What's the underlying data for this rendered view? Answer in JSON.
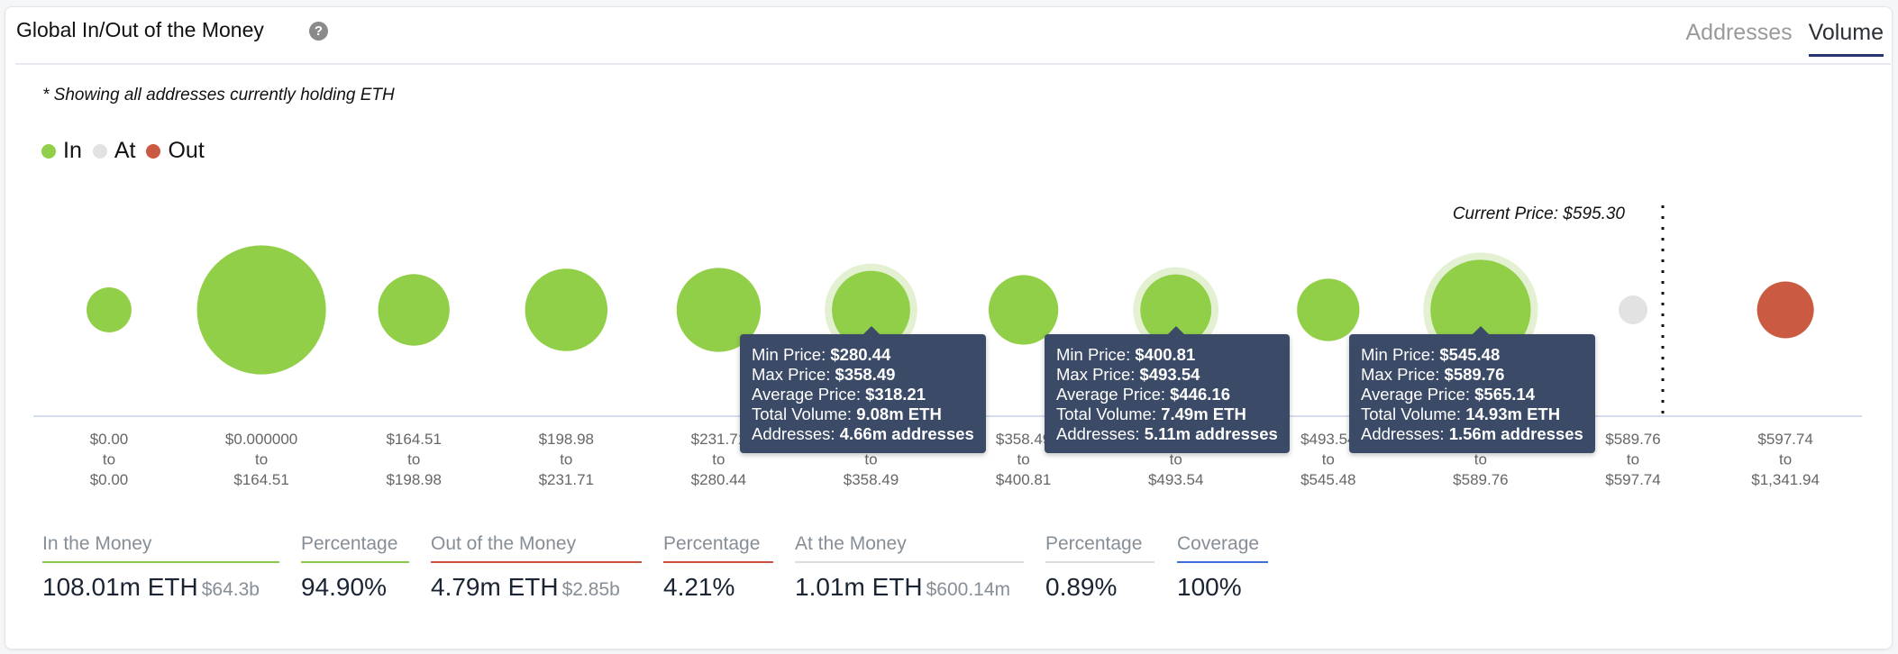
{
  "header": {
    "title": "Global In/Out of the Money",
    "help_icon": "question-circle-icon",
    "tabs": [
      {
        "label": "Addresses",
        "active": false
      },
      {
        "label": "Volume",
        "active": true
      }
    ]
  },
  "note": "* Showing all addresses currently holding ETH",
  "legend": [
    {
      "label": "In",
      "color": "#92cf48"
    },
    {
      "label": "At",
      "color": "#e2e2e2"
    },
    {
      "label": "Out",
      "color": "#cb5a43"
    }
  ],
  "chart_data": {
    "type": "scatter",
    "subtype": "bubble",
    "title": "Global In/Out of the Money",
    "size_metric": "Total Volume (m ETH)",
    "current_price_label": "Current Price: $595.30",
    "current_price": 595.3,
    "colors": {
      "In": "#92cf48",
      "At": "#e2e2e2",
      "Out": "#cb5a43",
      "halo": "#e3f1d2"
    },
    "buckets": [
      {
        "from": "$0.00",
        "to": "$0.00",
        "status": "In",
        "volume_m_eth": 3.0,
        "volume_estimated": true
      },
      {
        "from": "$0.000000",
        "to": "$164.51",
        "status": "In",
        "volume_m_eth": 24.7,
        "volume_estimated": true
      },
      {
        "from": "$164.51",
        "to": "$198.98",
        "status": "In",
        "volume_m_eth": 7.6,
        "volume_estimated": true
      },
      {
        "from": "$198.98",
        "to": "$231.71",
        "status": "In",
        "volume_m_eth": 10.1,
        "volume_estimated": true
      },
      {
        "from": "$231.71",
        "to": "$280.44",
        "status": "In",
        "volume_m_eth": 10.5,
        "volume_estimated": true
      },
      {
        "from": "$280.44",
        "to": "$358.49",
        "status": "In",
        "volume_m_eth": 9.08,
        "volume_estimated": false,
        "highlighted": true,
        "tooltip": {
          "min_price": "$280.44",
          "max_price": "$358.49",
          "avg_price": "$318.21",
          "total_volume": "9.08m ETH",
          "addresses": "4.66m addresses"
        }
      },
      {
        "from": "$358.49",
        "to": "$400.81",
        "status": "In",
        "volume_m_eth": 7.2,
        "volume_estimated": true
      },
      {
        "from": "$400.81",
        "to": "$493.54",
        "status": "In",
        "volume_m_eth": 7.49,
        "volume_estimated": false,
        "highlighted": true,
        "tooltip": {
          "min_price": "$400.81",
          "max_price": "$493.54",
          "avg_price": "$446.16",
          "total_volume": "7.49m ETH",
          "addresses": "5.11m addresses"
        }
      },
      {
        "from": "$493.54",
        "to": "$545.48",
        "status": "In",
        "volume_m_eth": 5.8,
        "volume_estimated": true
      },
      {
        "from": "$545.48",
        "to": "$589.76",
        "status": "In",
        "volume_m_eth": 14.93,
        "volume_estimated": false,
        "highlighted": true,
        "tooltip": {
          "min_price": "$545.48",
          "max_price": "$589.76",
          "avg_price": "$565.14",
          "total_volume": "14.93m ETH",
          "addresses": "1.56m addresses"
        }
      },
      {
        "from": "$589.76",
        "to": "$597.74",
        "status": "At",
        "volume_m_eth": 1.01,
        "volume_estimated": true
      },
      {
        "from": "$597.74",
        "to": "$1,341.94",
        "status": "Out",
        "volume_m_eth": 4.79,
        "volume_estimated": true
      }
    ],
    "tooltip_labels": {
      "min_price": "Min Price:",
      "max_price": "Max Price:",
      "avg_price": "Average Price:",
      "total_volume": "Total Volume:",
      "addresses": "Addresses:"
    },
    "to_word": "to"
  },
  "stats": [
    {
      "label": "In the Money",
      "value": "108.01m ETH",
      "sub": "$64.3b",
      "rule_color": "#8cc84b"
    },
    {
      "label": "Percentage",
      "value": "94.90%",
      "sub": "",
      "rule_color": "#8cc84b"
    },
    {
      "label": "Out of the Money",
      "value": "4.79m ETH",
      "sub": "$2.85b",
      "rule_color": "#c9553f"
    },
    {
      "label": "Percentage",
      "value": "4.21%",
      "sub": "",
      "rule_color": "#c9553f"
    },
    {
      "label": "At the Money",
      "value": "1.01m ETH",
      "sub": "$600.14m",
      "rule_color": "#dcdcdc"
    },
    {
      "label": "Percentage",
      "value": "0.89%",
      "sub": "",
      "rule_color": "#dcdcdc"
    },
    {
      "label": "Coverage",
      "value": "100%",
      "sub": "",
      "rule_color": "#3a6fd8"
    }
  ]
}
